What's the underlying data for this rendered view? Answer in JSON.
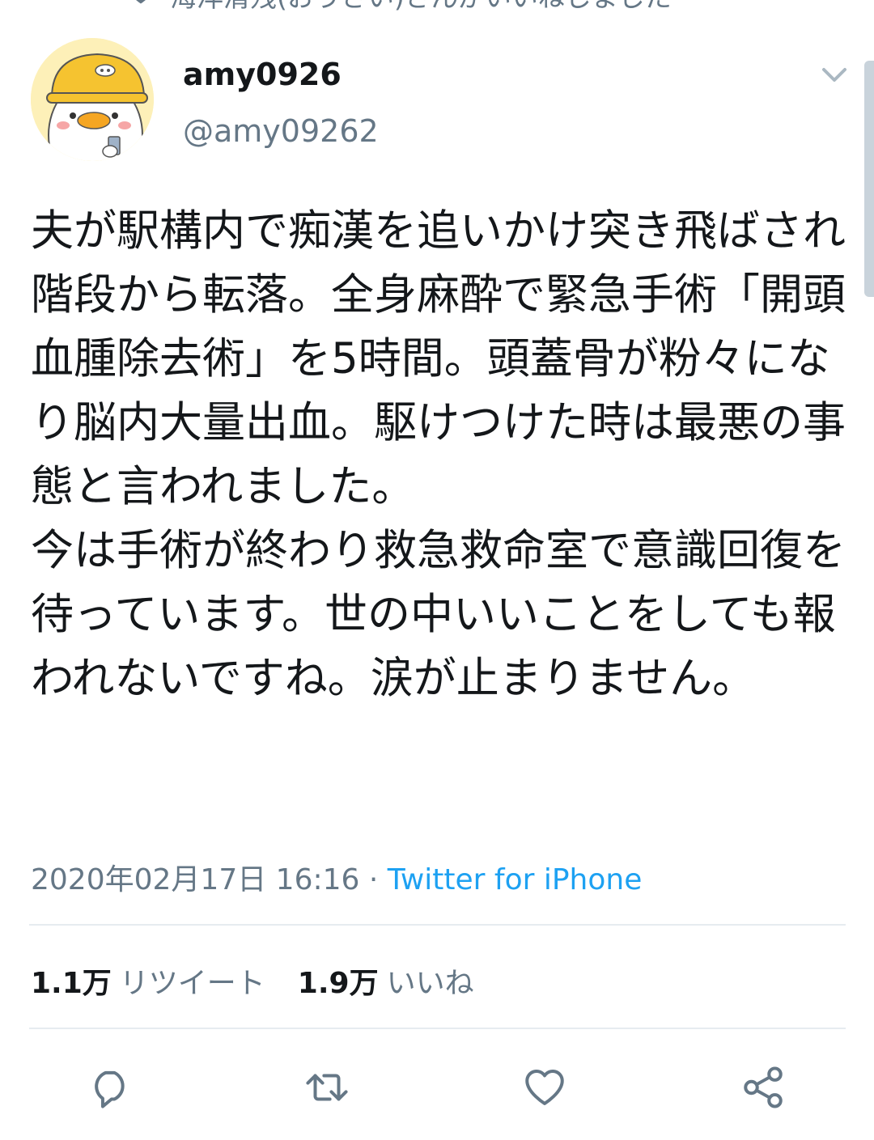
{
  "social_context": {
    "text": "海洋清残(おうさい)さんがいいねしました",
    "icon": "heart-icon"
  },
  "user": {
    "display_name": "amy0926",
    "handle": "@amy09262",
    "avatar_icon": "duck-avatar"
  },
  "tweet": {
    "text": "夫が駅構内で痴漢を追いかけ突き飛ばされ階段から転落。全身麻酔で緊急手術「開頭血腫除去術」を5時間。頭蓋骨が粉々になり脳内大量出血。駆けつけた時は最悪の事態と言われました。\n今は手術が終わり救急救命室で意識回復を待っています。世の中いいことをしても報われないですね。涙が止まりません。",
    "timestamp": "2020年02月17日 16:16",
    "separator": "·",
    "source": "Twitter for iPhone"
  },
  "stats": {
    "retweets_count": "1.1万",
    "retweets_label": "リツイート",
    "likes_count": "1.9万",
    "likes_label": "いいね"
  },
  "actions": [
    {
      "name": "reply",
      "icon": "reply-icon"
    },
    {
      "name": "retweet",
      "icon": "retweet-icon"
    },
    {
      "name": "like",
      "icon": "heart-icon"
    },
    {
      "name": "share",
      "icon": "share-icon"
    }
  ],
  "colors": {
    "text": "#14171a",
    "secondary": "#657786",
    "accent": "#1da1f2",
    "divider": "#e6ecf0"
  }
}
